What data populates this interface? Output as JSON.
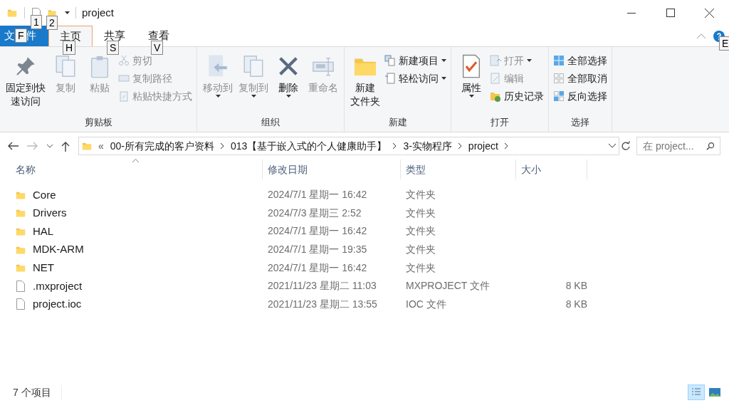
{
  "window": {
    "title": "project"
  },
  "quick_access": [
    {
      "keytip": "1"
    },
    {
      "keytip": "2"
    }
  ],
  "tabs": [
    {
      "label": "文件",
      "kind": "file",
      "selected": false,
      "keytip": "F"
    },
    {
      "label": "主页",
      "kind": "tab",
      "selected": true,
      "keytip": "H"
    },
    {
      "label": "共享",
      "kind": "tab",
      "selected": false,
      "keytip": "S"
    },
    {
      "label": "查看",
      "kind": "tab",
      "selected": false,
      "keytip": "V"
    }
  ],
  "help": {
    "keytip": "E"
  },
  "ribbon": [
    {
      "label": "剪贴板",
      "items": [
        {
          "kind": "large",
          "lines": [
            "固定到快",
            "速访问"
          ],
          "disabled": false,
          "dropdown": false
        },
        {
          "kind": "large",
          "label": "复制",
          "disabled": true,
          "dropdown": false
        },
        {
          "kind": "large",
          "label": "粘贴",
          "disabled": true,
          "dropdown": false
        },
        {
          "kind": "small",
          "label": "剪切",
          "disabled": true,
          "dropdown": false
        },
        {
          "kind": "small",
          "label": "复制路径",
          "disabled": true,
          "dropdown": false
        },
        {
          "kind": "small",
          "label": "粘贴快捷方式",
          "disabled": true,
          "dropdown": false
        }
      ]
    },
    {
      "label": "组织",
      "items": [
        {
          "kind": "large",
          "label": "移动到",
          "disabled": true,
          "dropdown": true
        },
        {
          "kind": "large",
          "label": "复制到",
          "disabled": true,
          "dropdown": true
        },
        {
          "kind": "large",
          "label": "删除",
          "disabled": false,
          "dropdown": true
        },
        {
          "kind": "large",
          "label": "重命名",
          "disabled": true,
          "dropdown": false
        }
      ]
    },
    {
      "label": "新建",
      "items": [
        {
          "kind": "large",
          "lines": [
            "新建",
            "文件夹"
          ],
          "disabled": false,
          "dropdown": false
        },
        {
          "kind": "small",
          "label": "新建项目",
          "disabled": false,
          "dropdown": true
        },
        {
          "kind": "small",
          "label": "轻松访问",
          "disabled": false,
          "dropdown": true
        }
      ]
    },
    {
      "label": "打开",
      "items": [
        {
          "kind": "large",
          "label": "属性",
          "disabled": false,
          "dropdown": true
        },
        {
          "kind": "small",
          "label": "打开",
          "disabled": true,
          "dropdown": true
        },
        {
          "kind": "small",
          "label": "编辑",
          "disabled": true,
          "dropdown": false
        },
        {
          "kind": "small",
          "label": "历史记录",
          "disabled": false,
          "dropdown": false
        }
      ]
    },
    {
      "label": "选择",
      "items": [
        {
          "kind": "small",
          "label": "全部选择",
          "disabled": false,
          "dropdown": false
        },
        {
          "kind": "small",
          "label": "全部取消",
          "disabled": false,
          "dropdown": false
        },
        {
          "kind": "small",
          "label": "反向选择",
          "disabled": false,
          "dropdown": false
        }
      ]
    }
  ],
  "address": {
    "overflow": "«",
    "crumbs": [
      "00-所有完成的客户资料",
      "013【基于嵌入式的个人健康助手】",
      "3-实物程序",
      "project"
    ]
  },
  "search": {
    "placeholder": "在 project..."
  },
  "table": {
    "columns": [
      "名称",
      "修改日期",
      "类型",
      "大小"
    ],
    "rows": [
      {
        "kind": "folder",
        "name": "Core",
        "date": "2024/7/1 星期一 16:42",
        "type": "文件夹"
      },
      {
        "kind": "folder",
        "name": "Drivers",
        "date": "2024/7/3 星期三 2:52",
        "type": "文件夹"
      },
      {
        "kind": "folder",
        "name": "HAL",
        "date": "2024/7/1 星期一 16:42",
        "type": "文件夹"
      },
      {
        "kind": "folder",
        "name": "MDK-ARM",
        "date": "2024/7/1 星期一 19:35",
        "type": "文件夹"
      },
      {
        "kind": "folder",
        "name": "NET",
        "date": "2024/7/1 星期一 16:42",
        "type": "文件夹"
      },
      {
        "kind": "file",
        "name": ".mxproject",
        "date": "2021/11/23 星期二 11:03",
        "type": "MXPROJECT 文件",
        "size": "8 KB"
      },
      {
        "kind": "file",
        "name": "project.ioc",
        "date": "2021/11/23 星期二 13:55",
        "type": "IOC 文件",
        "size": "8 KB"
      }
    ]
  },
  "status_bar": {
    "count": "7 个项目",
    "views": [
      {
        "selected": true
      },
      {
        "selected": false
      }
    ]
  }
}
